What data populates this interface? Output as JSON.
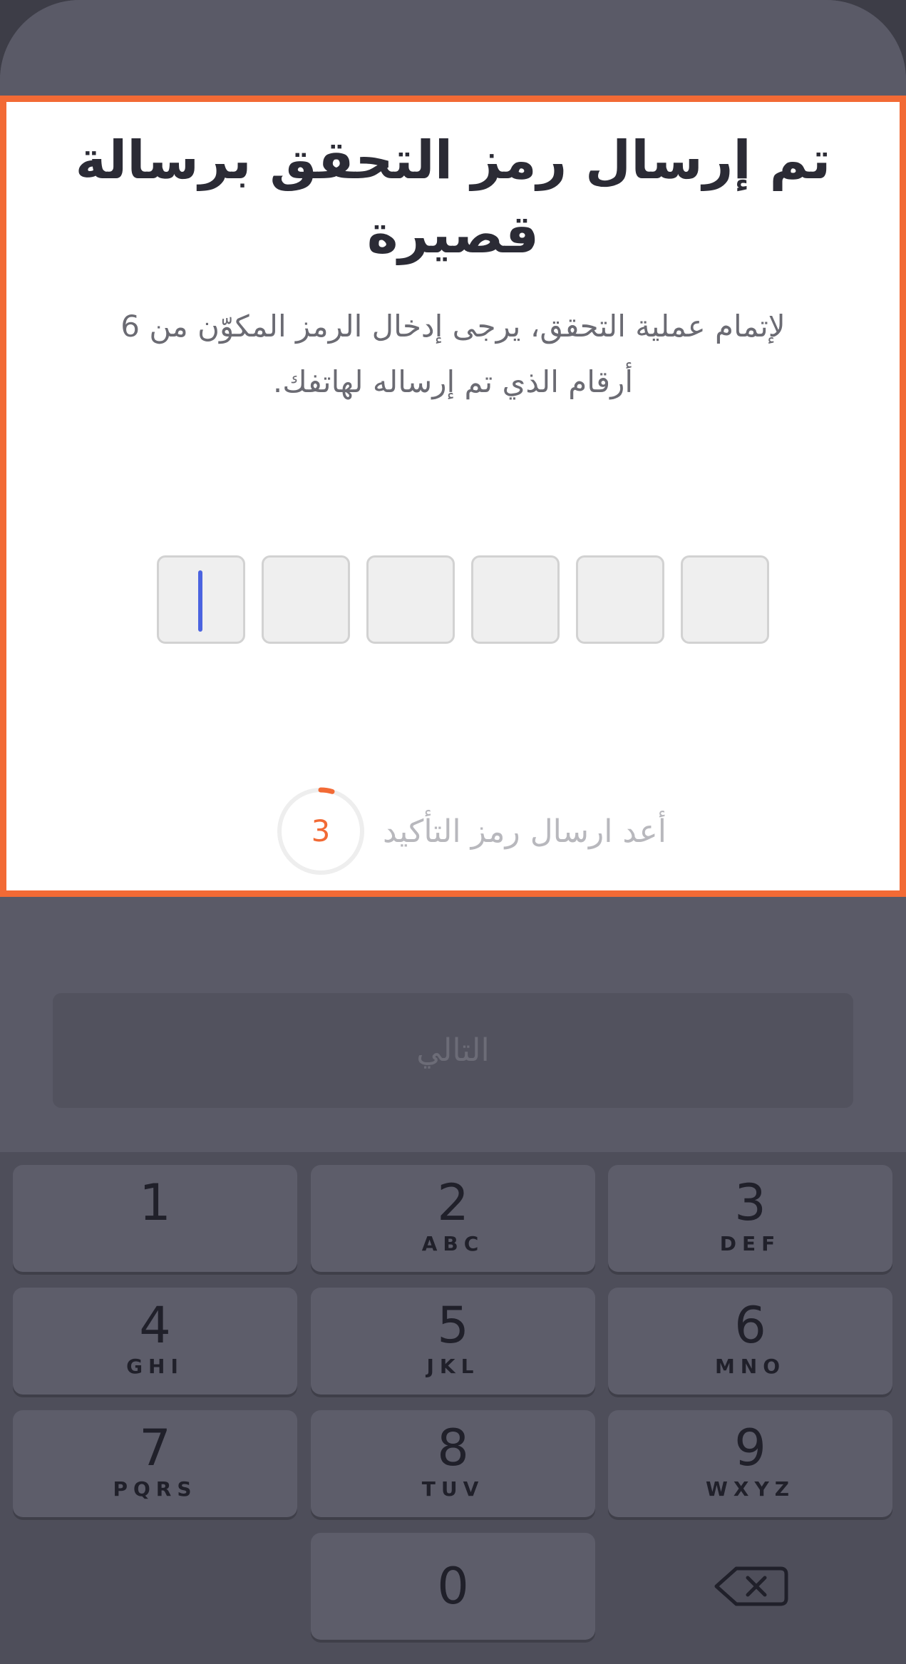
{
  "verification": {
    "title": "تم إرسال رمز التحقق برسالة قصيرة",
    "description": "لإتمام عملية التحقق، يرجى إدخال الرمز المكوّن من 6 أرقام الذي تم إرساله لهاتفك."
  },
  "otp": {
    "digits": [
      "",
      "",
      "",
      "",
      "",
      ""
    ]
  },
  "resend": {
    "timer_value": "3",
    "label": "أعد ارسال رمز التأكيد"
  },
  "next_button": {
    "label": "التالي"
  },
  "keypad": {
    "keys": [
      {
        "num": "1",
        "letters": ""
      },
      {
        "num": "2",
        "letters": "ABC"
      },
      {
        "num": "3",
        "letters": "DEF"
      },
      {
        "num": "4",
        "letters": "GHI"
      },
      {
        "num": "5",
        "letters": "JKL"
      },
      {
        "num": "6",
        "letters": "MNO"
      },
      {
        "num": "7",
        "letters": "PQRS"
      },
      {
        "num": "8",
        "letters": "TUV"
      },
      {
        "num": "9",
        "letters": "WXYZ"
      },
      {
        "num": "0",
        "letters": ""
      }
    ]
  },
  "colors": {
    "accent": "#f26a35",
    "caret": "#4b63e0"
  },
  "icons": {
    "backspace": "backspace-icon"
  }
}
